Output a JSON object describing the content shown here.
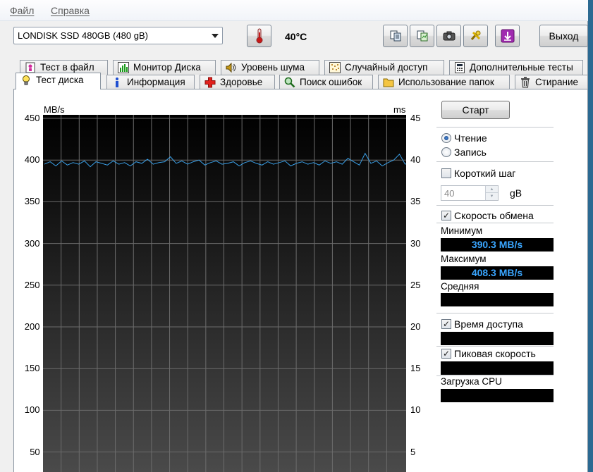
{
  "menu": {
    "file": "Файл",
    "help": "Справка"
  },
  "toolbar": {
    "drive": "LONDISK SSD 480GB (480 gB)",
    "temperature": "40°C",
    "exit_label": "Выход"
  },
  "tabs_top": [
    {
      "label": "Тест в файл"
    },
    {
      "label": "Монитор Диска"
    },
    {
      "label": "Уровень шума"
    },
    {
      "label": "Случайный доступ"
    },
    {
      "label": "Дополнительные  тесты"
    }
  ],
  "tabs_bottom": [
    {
      "label": "Тест диска"
    },
    {
      "label": "Информация"
    },
    {
      "label": "Здоровье"
    },
    {
      "label": "Поиск ошибок"
    },
    {
      "label": "Использование папок"
    },
    {
      "label": "Стирание"
    }
  ],
  "chart": {
    "left_unit": "MB/s",
    "right_unit": "ms",
    "left_ticks": [
      "450",
      "400",
      "350",
      "300",
      "250",
      "200",
      "150",
      "100",
      "50"
    ],
    "right_ticks": [
      "45",
      "40",
      "35",
      "30",
      "25",
      "20",
      "15",
      "10",
      "5"
    ]
  },
  "chart_data": {
    "type": "line",
    "xlabel": "",
    "ylabel": "MB/s",
    "y2label": "ms",
    "ylim": [
      0,
      450
    ],
    "y2lim": [
      0,
      45
    ],
    "x": [
      0,
      1,
      2,
      3,
      4,
      5,
      6,
      7,
      8,
      9,
      10,
      11,
      12,
      13,
      14,
      15,
      16,
      17,
      18,
      19,
      20,
      21,
      22,
      23,
      24,
      25,
      26,
      27,
      28,
      29,
      30,
      31,
      32,
      33,
      34,
      35,
      36,
      37,
      38,
      39,
      40,
      41,
      42,
      43,
      44,
      45,
      46,
      47,
      48,
      49,
      50,
      51,
      52,
      53,
      54,
      55,
      56,
      57,
      58,
      59,
      60,
      61,
      62,
      63,
      64,
      65,
      66,
      67,
      68,
      69,
      70
    ],
    "xlim": [
      0,
      130
    ],
    "series": [
      {
        "color": "#3aa0e8",
        "values": [
          395,
          398,
          393,
          399,
          394,
          397,
          395,
          399,
          392,
          398,
          396,
          394,
          399,
          395,
          397,
          393,
          398,
          396,
          401,
          395,
          397,
          398,
          404,
          396,
          399,
          395,
          398,
          400,
          394,
          397,
          399,
          395,
          396,
          398,
          393,
          397,
          399,
          396,
          394,
          398,
          395,
          397,
          399,
          393,
          396,
          398,
          395,
          397,
          394,
          399,
          396,
          398,
          395,
          402,
          398,
          394,
          408,
          396,
          399,
          393,
          397,
          400,
          407,
          395,
          398,
          403,
          394,
          399,
          396,
          397,
          395
        ]
      }
    ],
    "grid": true
  },
  "panel": {
    "start_label": "Старт",
    "read_label": "Чтение",
    "write_label": "Запись",
    "short_step_label": "Короткий шаг",
    "step_value": "40",
    "step_unit": "gB",
    "transfer_rate_label": "Скорость обмена",
    "min_label": "Минимум",
    "min_value": "390.3 MB/s",
    "max_label": "Максимум",
    "max_value": "408.3 MB/s",
    "avg_label": "Средняя",
    "access_time_label": "Время доступа",
    "burst_rate_label": "Пиковая скорость",
    "cpu_label": "Загрузка CPU"
  }
}
